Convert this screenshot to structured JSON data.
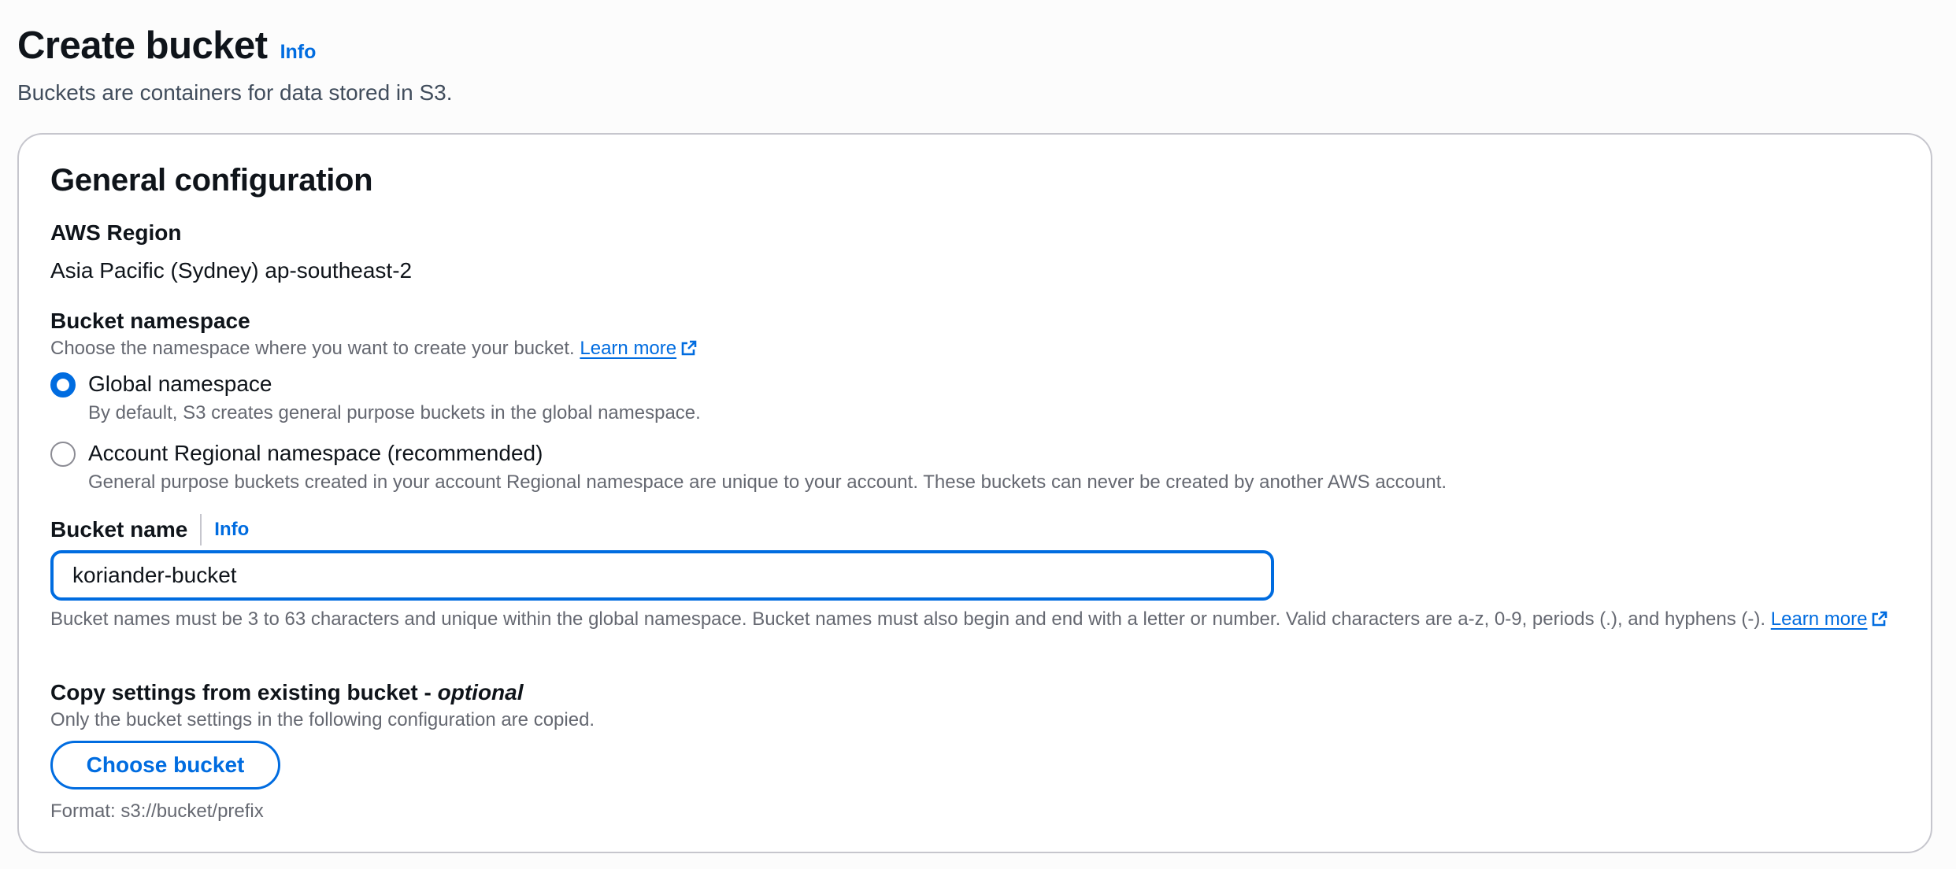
{
  "header": {
    "title": "Create bucket",
    "info_label": "Info",
    "description": "Buckets are containers for data stored in S3."
  },
  "general_config": {
    "title": "General configuration",
    "region": {
      "label": "AWS Region",
      "value": "Asia Pacific (Sydney) ap-southeast-2"
    },
    "namespace": {
      "label": "Bucket namespace",
      "description": "Choose the namespace where you want to create your bucket.",
      "learn_more": "Learn more",
      "options": [
        {
          "label": "Global namespace",
          "description": "By default, S3 creates general purpose buckets in the global namespace.",
          "selected": true
        },
        {
          "label": "Account Regional namespace (recommended)",
          "description": "General purpose buckets created in your account Regional namespace are unique to your account. These buckets can never be created by another AWS account.",
          "selected": false
        }
      ]
    },
    "bucket_name": {
      "label": "Bucket name",
      "info_label": "Info",
      "value": "koriander-bucket",
      "constraint_text": "Bucket names must be 3 to 63 characters and unique within the global namespace. Bucket names must also begin and end with a letter or number. Valid characters are a-z, 0-9, periods (.), and hyphens (-).",
      "learn_more": "Learn more"
    },
    "copy_settings": {
      "label": "Copy settings from existing bucket - ",
      "label_optional": "optional",
      "description": "Only the bucket settings in the following configuration are copied.",
      "button_label": "Choose bucket",
      "format_hint": "Format: s3://bucket/prefix"
    }
  },
  "colors": {
    "accent": "#006ce0",
    "text_primary": "#0f141a",
    "text_secondary": "#656871",
    "border": "#c6c6cd"
  }
}
